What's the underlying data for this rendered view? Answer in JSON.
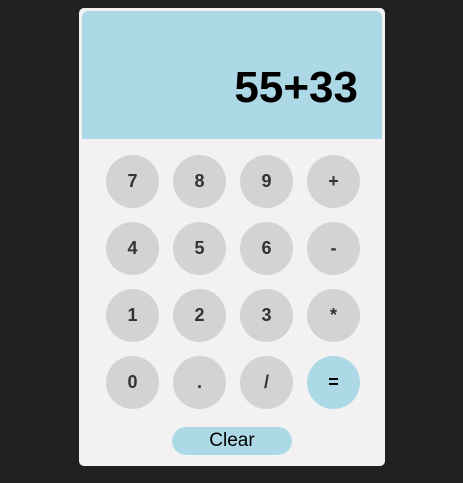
{
  "display": {
    "expression": "55+33"
  },
  "keypad": {
    "keys": [
      "7",
      "8",
      "9",
      "+",
      "4",
      "5",
      "6",
      "-",
      "1",
      "2",
      "3",
      "*",
      "0",
      ".",
      "/",
      "="
    ]
  },
  "clear_label": "Clear",
  "colors": {
    "page_background": "#212121",
    "calculator_background": "#f2f2f2",
    "display_background": "#add8e6",
    "key_background": "#d3d3d3",
    "equals_background": "#add8e6",
    "clear_background": "#add8e6"
  }
}
